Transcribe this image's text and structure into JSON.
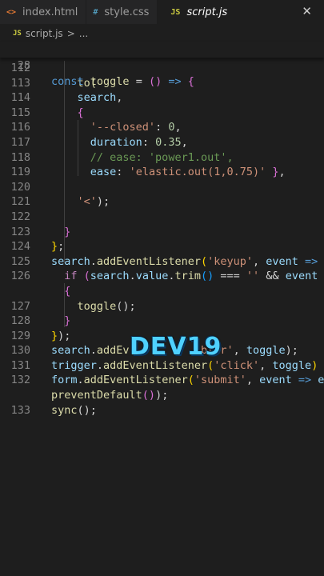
{
  "tabs": [
    {
      "icon": "<>",
      "label": "index.html"
    },
    {
      "icon": "#",
      "label": "style.css"
    },
    {
      "icon": "JS",
      "label": "script.js",
      "close": "✕"
    }
  ],
  "breadcrumb": {
    "icon": "JS",
    "file": "script.js",
    "separator": ">",
    "more": "..."
  },
  "sticky": {
    "line_number": "28",
    "code": "const toggle = () => {"
  },
  "lines": [
    {
      "n": "112",
      "tokens": []
    },
    {
      "n": "113",
      "tokens": [
        {
          "t": "to(",
          "c": "fn"
        }
      ]
    },
    {
      "n": "114",
      "tokens": [
        {
          "t": "search",
          "c": "var"
        },
        {
          "t": ",",
          "c": "txt"
        }
      ]
    },
    {
      "n": "115",
      "tokens": [
        {
          "t": "{",
          "c": "br2"
        }
      ]
    },
    {
      "n": "116",
      "tokens": [
        {
          "t": "'--closed'",
          "c": "str"
        },
        {
          "t": ": ",
          "c": "txt"
        },
        {
          "t": "0",
          "c": "num"
        },
        {
          "t": ",",
          "c": "txt"
        }
      ]
    },
    {
      "n": "117",
      "tokens": [
        {
          "t": "duration",
          "c": "var"
        },
        {
          "t": ": ",
          "c": "txt"
        },
        {
          "t": "0.35",
          "c": "num"
        },
        {
          "t": ",",
          "c": "txt"
        }
      ]
    },
    {
      "n": "118",
      "tokens": [
        {
          "t": "// ease: 'power1.out',",
          "c": "com"
        }
      ]
    },
    {
      "n": "119",
      "tokens": [
        {
          "t": "ease",
          "c": "var"
        },
        {
          "t": ": ",
          "c": "txt"
        },
        {
          "t": "'elastic.out(1,0.75)'",
          "c": "str"
        },
        {
          "t": " }",
          "c": "br2"
        },
        {
          "t": ",",
          "c": "txt"
        }
      ]
    },
    {
      "n": "120",
      "tokens": []
    },
    {
      "n": "121",
      "tokens": [
        {
          "t": "'<'",
          "c": "str"
        },
        {
          "t": ");",
          "c": "txt"
        }
      ]
    },
    {
      "n": "122",
      "tokens": []
    },
    {
      "n": "123",
      "tokens": [
        {
          "t": "}",
          "c": "br2"
        }
      ]
    },
    {
      "n": "124",
      "tokens": [
        {
          "t": "}",
          "c": "br1"
        },
        {
          "t": ";",
          "c": "txt"
        }
      ]
    },
    {
      "n": "125",
      "tokens": [
        {
          "t": "search",
          "c": "var"
        },
        {
          "t": ".",
          "c": "txt"
        },
        {
          "t": "addEventListener",
          "c": "fn"
        },
        {
          "t": "(",
          "c": "br1"
        },
        {
          "t": "'keyup'",
          "c": "str"
        },
        {
          "t": ", ",
          "c": "txt"
        },
        {
          "t": "event",
          "c": "var"
        },
        {
          "t": " =>",
          "c": "kw"
        }
      ]
    },
    {
      "n": "126",
      "tokens": [
        {
          "t": "if",
          "c": "kw2"
        },
        {
          "t": " (",
          "c": "br2"
        },
        {
          "t": "search",
          "c": "var"
        },
        {
          "t": ".",
          "c": "txt"
        },
        {
          "t": "value",
          "c": "var"
        },
        {
          "t": ".",
          "c": "txt"
        },
        {
          "t": "trim",
          "c": "fn"
        },
        {
          "t": "()",
          "c": "br3"
        },
        {
          "t": " === ",
          "c": "txt"
        },
        {
          "t": "''",
          "c": "str"
        },
        {
          "t": " && ",
          "c": "txt"
        },
        {
          "t": "event",
          "c": "var"
        }
      ]
    },
    {
      "n": "",
      "tokens": [
        {
          "t": "{",
          "c": "br2"
        }
      ]
    },
    {
      "n": "127",
      "tokens": [
        {
          "t": "toggle",
          "c": "fn"
        },
        {
          "t": "();",
          "c": "txt"
        }
      ]
    },
    {
      "n": "128",
      "tokens": [
        {
          "t": "}",
          "c": "br2"
        }
      ]
    },
    {
      "n": "129",
      "tokens": [
        {
          "t": "}",
          "c": "br1"
        },
        {
          "t": ");",
          "c": "txt"
        }
      ]
    },
    {
      "n": "130",
      "tokens": [
        {
          "t": "search",
          "c": "var"
        },
        {
          "t": ".",
          "c": "txt"
        },
        {
          "t": "addEv",
          "c": "fn"
        },
        {
          "t": "          ",
          "c": "txt"
        },
        {
          "t": "'blur'",
          "c": "str"
        },
        {
          "t": ", ",
          "c": "txt"
        },
        {
          "t": "toggle",
          "c": "var"
        },
        {
          "t": ");",
          "c": "txt"
        }
      ]
    },
    {
      "n": "131",
      "tokens": [
        {
          "t": "trigger",
          "c": "var"
        },
        {
          "t": ".",
          "c": "txt"
        },
        {
          "t": "addEventListener",
          "c": "fn"
        },
        {
          "t": "(",
          "c": "br1"
        },
        {
          "t": "'click'",
          "c": "str"
        },
        {
          "t": ", ",
          "c": "txt"
        },
        {
          "t": "toggle",
          "c": "var"
        },
        {
          "t": ")",
          "c": "br1"
        }
      ]
    },
    {
      "n": "132",
      "tokens": [
        {
          "t": "form",
          "c": "var"
        },
        {
          "t": ".",
          "c": "txt"
        },
        {
          "t": "addEventListener",
          "c": "fn"
        },
        {
          "t": "(",
          "c": "br1"
        },
        {
          "t": "'submit'",
          "c": "str"
        },
        {
          "t": ", ",
          "c": "txt"
        },
        {
          "t": "event",
          "c": "var"
        },
        {
          "t": " => ",
          "c": "kw"
        },
        {
          "t": "e",
          "c": "var"
        }
      ]
    },
    {
      "n": "",
      "tokens": [
        {
          "t": "preventDefault",
          "c": "fn"
        },
        {
          "t": "()",
          "c": "br2"
        },
        {
          "t": ");",
          "c": "txt"
        }
      ]
    },
    {
      "n": "133",
      "tokens": [
        {
          "t": "sync",
          "c": "fn"
        },
        {
          "t": "();",
          "c": "txt"
        }
      ]
    }
  ],
  "watermark": "DEV19",
  "colors": {
    "background": "#1e1e1e",
    "tabbar": "#252526",
    "keyword": "#569cd6",
    "function": "#dcdcaa",
    "variable": "#9cdcfe",
    "string": "#ce9178",
    "number": "#b5cea8",
    "comment": "#6a9955",
    "watermark": "#4fd1ff"
  }
}
